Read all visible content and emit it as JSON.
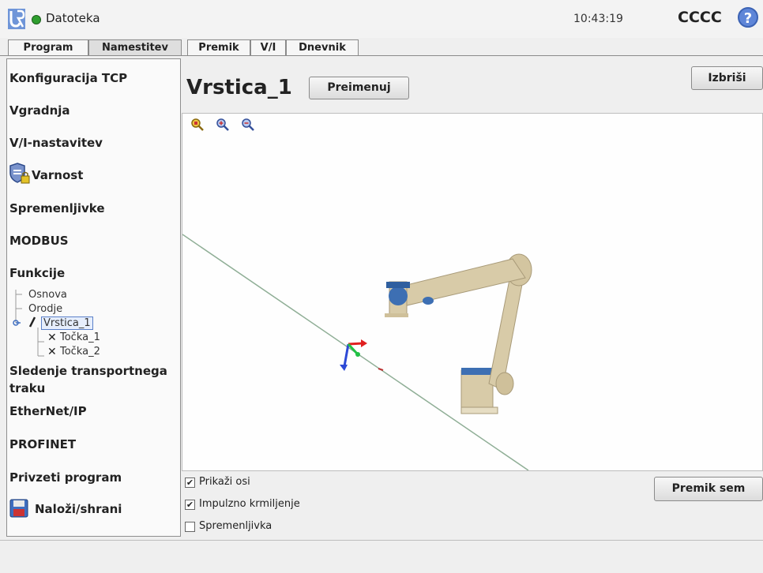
{
  "header": {
    "file_label": "Datoteka",
    "clock": "10:43:19",
    "robot_name": "CCCC",
    "help_symbol": "?",
    "status_color": "#2e9e2e"
  },
  "tabs": [
    {
      "label": "Program",
      "active": false
    },
    {
      "label": "Namestitev",
      "active": true
    },
    {
      "label": "Premik",
      "active": false
    },
    {
      "label": "V/I",
      "active": false
    },
    {
      "label": "Dnevnik",
      "active": false
    }
  ],
  "sidebar": {
    "items": [
      {
        "label": "Konfiguracija TCP"
      },
      {
        "label": "Vgradnja"
      },
      {
        "label": "V/I-nastavitev"
      },
      {
        "label": "Varnost",
        "icon": "shield-lock-icon"
      },
      {
        "label": "Spremenljivke"
      },
      {
        "label": "MODBUS"
      },
      {
        "label": "Funkcije"
      },
      {
        "label": "Sledenje transportnega traku"
      },
      {
        "label": "EtherNet/IP"
      },
      {
        "label": "PROFINET"
      },
      {
        "label": "Privzeti program"
      },
      {
        "label": "Naloži/shrani",
        "icon": "floppy-disk-icon"
      }
    ],
    "tree": {
      "base": "Osnova",
      "tool": "Orodje",
      "line": "Vrstica_1",
      "point1": "Točka_1",
      "point2": "Točka_2"
    }
  },
  "main": {
    "title": "Vrstica_1",
    "rename_label": "Preimenuj",
    "delete_label": "Izbriši",
    "move_here_label": "Premik sem",
    "zoom_icons": [
      "zoom-fit-icon",
      "zoom-in-icon",
      "zoom-out-icon"
    ]
  },
  "options": [
    {
      "label": "Prikaži osi",
      "checked": true
    },
    {
      "label": "Impulzno krmiljenje",
      "checked": true
    },
    {
      "label": "Spremenljivka",
      "checked": false
    }
  ],
  "check_mark": "✔",
  "colors": {
    "accent": "#5f86d8",
    "robot_body": "#d8cba8",
    "robot_joint": "#3d6fb3"
  }
}
